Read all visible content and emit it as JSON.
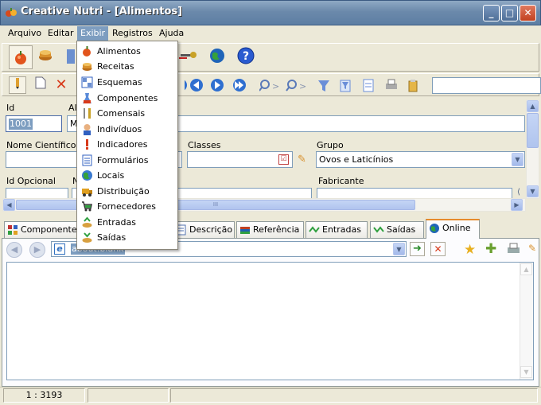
{
  "window": {
    "title": "Creative Nutri - [Alimentos]",
    "minimize": "_",
    "maximize": "□",
    "close": "✕"
  },
  "menubar": [
    {
      "label": "Arquivo"
    },
    {
      "label": "Editar"
    },
    {
      "label": "Exibir"
    },
    {
      "label": "Registros"
    },
    {
      "label": "Ajuda"
    }
  ],
  "exibir_menu": [
    {
      "label": "Alimentos",
      "icon": "apple-icon"
    },
    {
      "label": "Receitas",
      "icon": "recipe-cake-icon"
    },
    {
      "label": "Esquemas",
      "icon": "schema-grid-icon"
    },
    {
      "label": "Componentes",
      "icon": "flask-icon"
    },
    {
      "label": "Comensais",
      "icon": "cutlery-icon"
    },
    {
      "label": "Indivíduos",
      "icon": "person-icon"
    },
    {
      "label": "Indicadores",
      "icon": "exclamation-icon"
    },
    {
      "label": "Formulários",
      "icon": "form-icon"
    },
    {
      "label": "Locais",
      "icon": "globe-location-icon"
    },
    {
      "label": "Distribuição",
      "icon": "truck-icon"
    },
    {
      "label": "Fornecedores",
      "icon": "shopping-cart-icon"
    },
    {
      "label": "Entradas",
      "icon": "entries-icon"
    },
    {
      "label": "Saídas",
      "icon": "exits-icon"
    }
  ],
  "form": {
    "id_label": "Id",
    "id_value": "1001",
    "nome_label_partial": "Al",
    "nome_value_partial": "M",
    "nome_cientifico_label": "Nome Científico",
    "classes_label": "Classes",
    "grupo_label": "Grupo",
    "grupo_value": "Ovos e Laticínios",
    "id_opcional_label": "Id Opcional",
    "n_label_partial": "N",
    "fabricante_label": "Fabricante"
  },
  "scroll_thumb_text": "III",
  "tabs": [
    {
      "label": "Componentes",
      "icon": "components-icon"
    },
    {
      "label": "Descrição",
      "icon": "description-icon"
    },
    {
      "label": "Referência",
      "icon": "books-icon"
    },
    {
      "label": "Entradas",
      "icon": "entries-arrow-icon"
    },
    {
      "label": "Saídas",
      "icon": "exits-arrow-icon"
    },
    {
      "label": "Online",
      "icon": "globe-icon",
      "active": true
    }
  ],
  "browser": {
    "address": "about:blank"
  },
  "status": {
    "record": "1 : 3193"
  },
  "colors": {
    "menu_highlight": "#7d9dc0",
    "titlebar": "#6b89ab",
    "active_tab_border": "#e68b2c"
  }
}
